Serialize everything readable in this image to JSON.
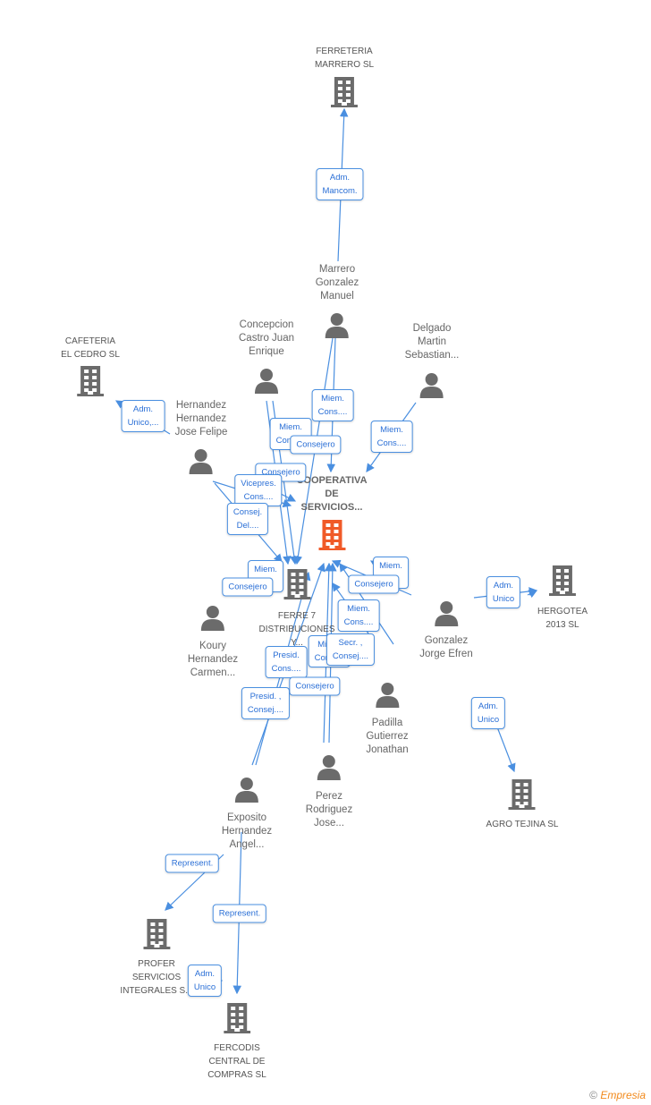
{
  "colors": {
    "edge": "#4a8fe0",
    "building": "#6b6b6b",
    "main_building": "#f05a28",
    "person": "#6b6b6b"
  },
  "nodes": [
    {
      "id": "ferreteria",
      "type": "company",
      "label": "FERRETERIA\nMARRERO  SL"
    },
    {
      "id": "marrero",
      "type": "person",
      "label": "Marrero\nGonzalez\nManuel"
    },
    {
      "id": "concepcion",
      "type": "person",
      "label": "Concepcion\nCastro Juan\nEnrique"
    },
    {
      "id": "delgado",
      "type": "person",
      "label": "Delgado\nMartin\nSebastian..."
    },
    {
      "id": "cafeteria",
      "type": "company",
      "label": "CAFETERIA\nEL CEDRO SL"
    },
    {
      "id": "hernandez",
      "type": "person",
      "label": "Hernandez\nHernandez\nJose Felipe"
    },
    {
      "id": "cooperativa",
      "type": "main",
      "label": "COOPERATIVA\nDE\nSERVICIOS..."
    },
    {
      "id": "ferre7",
      "type": "company",
      "label": "FERRE 7\nDISTRIBUCIONES\nY..."
    },
    {
      "id": "koury",
      "type": "person",
      "label": "Koury\nHernandez\nCarmen..."
    },
    {
      "id": "gonzalez",
      "type": "person",
      "label": "Gonzalez\nJorge Efren"
    },
    {
      "id": "hergotea",
      "type": "company",
      "label": "HERGOTEA\n2013  SL"
    },
    {
      "id": "padilla",
      "type": "person",
      "label": "Padilla\nGutierrez\nJonathan"
    },
    {
      "id": "perez",
      "type": "person",
      "label": "Perez\nRodriguez\nJose..."
    },
    {
      "id": "exposito",
      "type": "person",
      "label": "Exposito\nHernandez\nAngel..."
    },
    {
      "id": "agro",
      "type": "company",
      "label": "AGRO TEJINA SL"
    },
    {
      "id": "profer",
      "type": "company",
      "label": "PROFER\nSERVICIOS\nINTEGRALES S..."
    },
    {
      "id": "fercodis",
      "type": "company",
      "label": "FERCODIS\nCENTRAL DE\nCOMPRAS SL"
    }
  ],
  "edge_labels": [
    "Adm.\nMancom.",
    "Adm.\nUnico,...",
    "Miem.\nCons....",
    "Miem.\nCons....",
    "Consejero",
    "Miem.\nCons....",
    "Consejero",
    "Vicepres.\nCons....",
    "Consej.\nDel....",
    "Miem.\n...",
    "Consejero",
    "Miem.\n...",
    "Consejero",
    "Adm.\nUnico",
    "Miem.\nCons....",
    "Miem.\nCons....",
    "Secr. ,\nConsej....",
    "Presid.\nCons....",
    "Consejero",
    "Presid. ,\nConsej....",
    "Adm.\nUnico",
    "Represent.",
    "Represent.",
    "Adm.\nUnico"
  ],
  "brand": {
    "copyright": "©",
    "name": "Empresia"
  }
}
